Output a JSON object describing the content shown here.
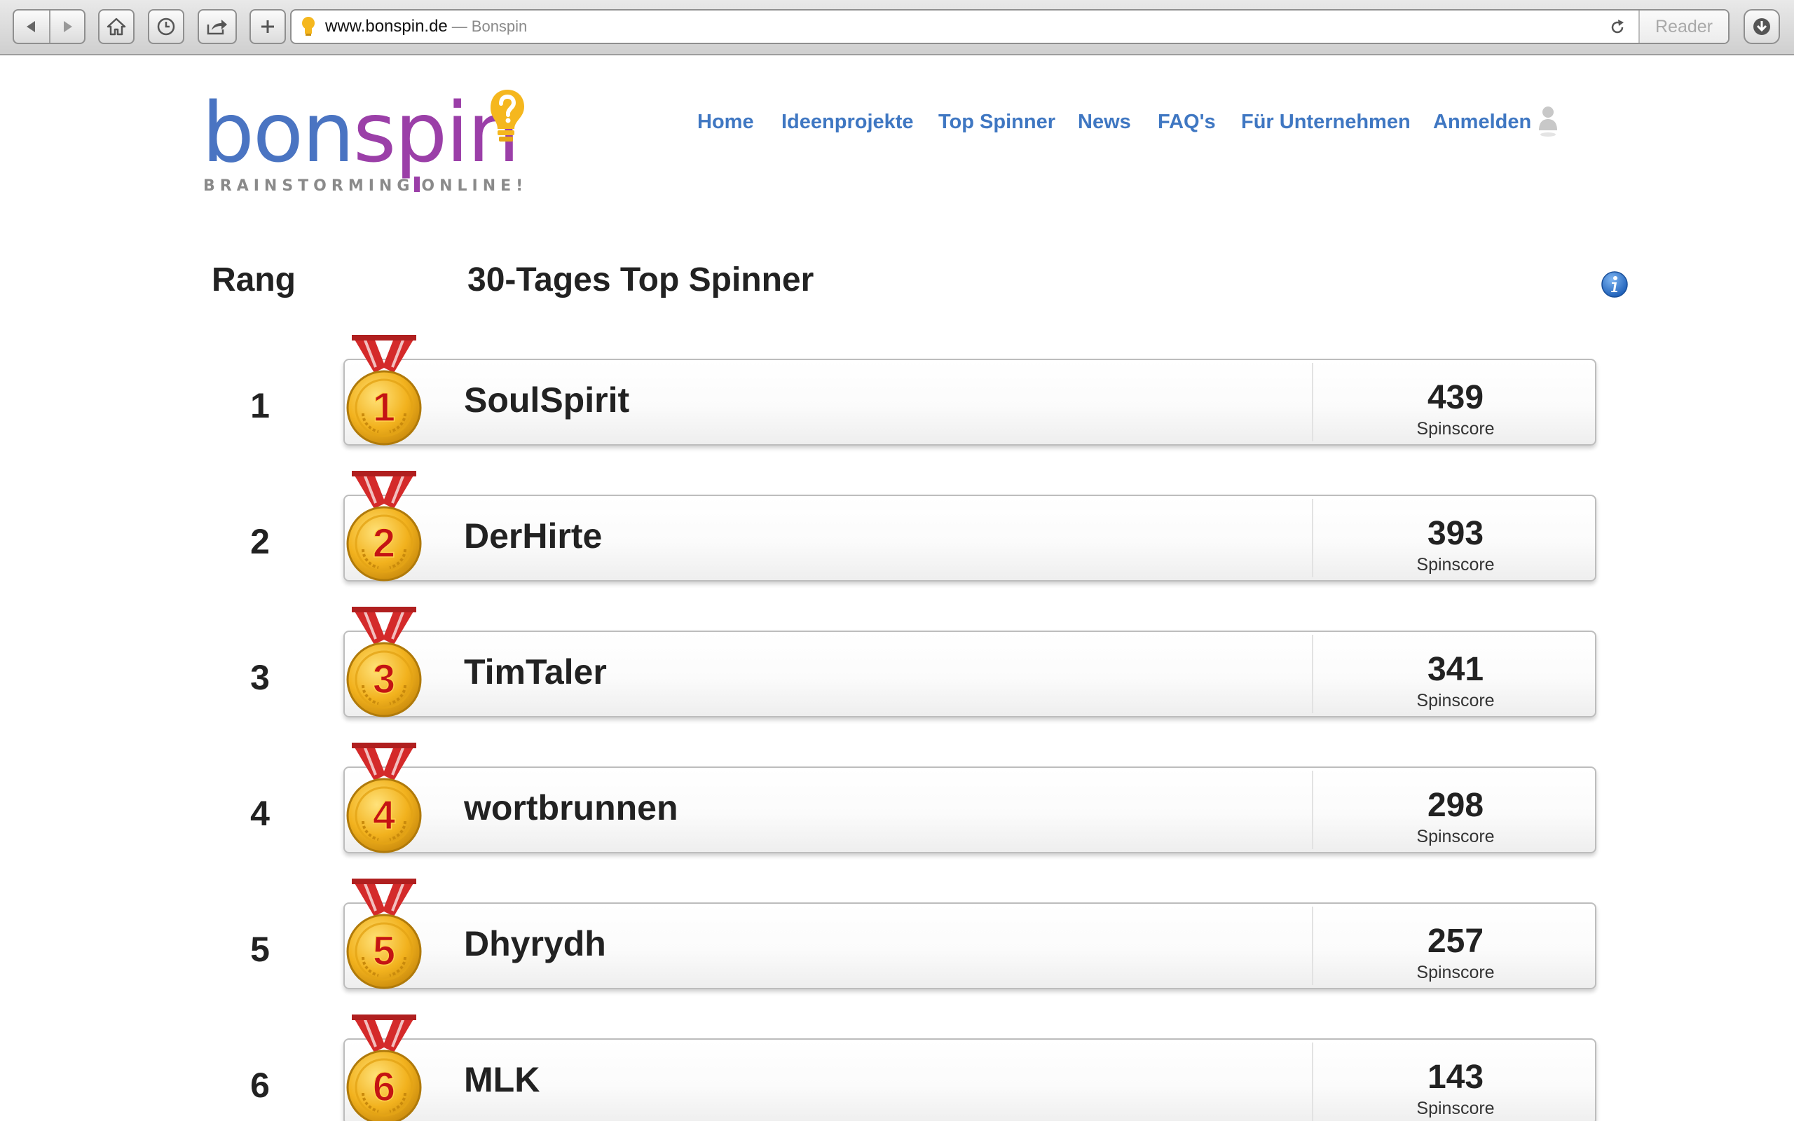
{
  "browser": {
    "url": "www.bonspin.de",
    "separator": "—",
    "page_title": "Bonspin",
    "reader_label": "Reader"
  },
  "logo": {
    "word_part1": "bon",
    "word_part2": "spin",
    "tagline_part1": "BRAINSTORMING",
    "tagline_part2": "ONLINE!"
  },
  "nav": {
    "items": [
      {
        "label": "Home"
      },
      {
        "label": "Ideenprojekte"
      },
      {
        "label": "Top Spinner"
      },
      {
        "label": "News"
      },
      {
        "label": "FAQ's"
      },
      {
        "label": "Für Unternehmen"
      },
      {
        "label": "Anmelden"
      }
    ]
  },
  "ranking": {
    "rank_header": "Rang",
    "title": "30-Tages Top Spinner",
    "score_label": "Spinscore",
    "entries": [
      {
        "rank": "1",
        "medal": "1",
        "name": "SoulSpirit",
        "score": "439"
      },
      {
        "rank": "2",
        "medal": "2",
        "name": "DerHirte",
        "score": "393"
      },
      {
        "rank": "3",
        "medal": "3",
        "name": "TimTaler",
        "score": "341"
      },
      {
        "rank": "4",
        "medal": "4",
        "name": "wortbrunnen",
        "score": "298"
      },
      {
        "rank": "5",
        "medal": "5",
        "name": "Dhyrydh",
        "score": "257"
      },
      {
        "rank": "6",
        "medal": "6",
        "name": "MLK",
        "score": "143"
      }
    ]
  },
  "colors": {
    "nav_link": "#3f77c2",
    "logo_blue": "#4a74c2",
    "logo_purple": "#9b3fa8",
    "medal_gold": "#f2b21e",
    "ribbon_red": "#d42a2a",
    "info_blue": "#2e74c9"
  }
}
